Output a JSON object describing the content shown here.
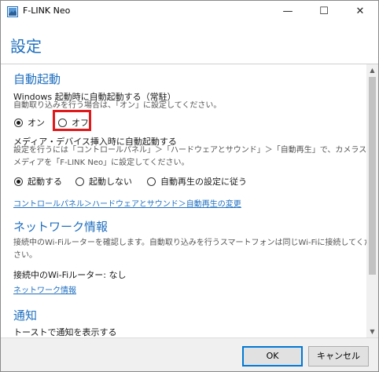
{
  "window": {
    "title": "F-LINK Neo",
    "minimize_glyph": "—",
    "maximize_glyph": "☐",
    "close_glyph": "✕"
  },
  "page": {
    "title": "設定"
  },
  "auto_start": {
    "heading": "自動起動",
    "windows_label": "Windows 起動時に自動起動する（常駐）",
    "windows_desc": "自動取り込みを行う場合は、「オン」に設定してください。",
    "options": [
      {
        "label": "オン",
        "selected": true
      },
      {
        "label": "オフ",
        "selected": false
      }
    ],
    "media_label": "メディア・デバイス挿入時に自動起動する",
    "media_desc_line1": "設定を行うには「コントロールパネル」＞「ハードウェアとサウンド」＞「自動再生」で、カメラストレージの",
    "media_desc_line2": "メディアを「F-LINK Neo」に設定してください。",
    "media_options": [
      {
        "label": "起動する",
        "selected": true
      },
      {
        "label": "起動しない",
        "selected": false
      },
      {
        "label": "自動再生の設定に従う",
        "selected": false
      }
    ],
    "autoplay_link": "コントロールパネル＞ハードウェアとサウンド＞自動再生の変更"
  },
  "network": {
    "heading": "ネットワーク情報",
    "desc_line1": "接続中のWi-Fiルーターを確認します。自動取り込みを行うスマートフォンは同じWi-Fiに接続してくだ",
    "desc_line2": "さい。",
    "router_label": "接続中のWi-Fiルーター: なし",
    "info_link": "ネットワーク情報"
  },
  "notification": {
    "heading": "通知",
    "toast_label": "トーストで通知を表示する"
  },
  "scrollbar": {
    "up_glyph": "▲",
    "down_glyph": "▼"
  },
  "footer": {
    "ok_label": "OK",
    "cancel_label": "キャンセル"
  },
  "colors": {
    "accent": "#1f6fbf",
    "highlight": "#e0191b"
  }
}
